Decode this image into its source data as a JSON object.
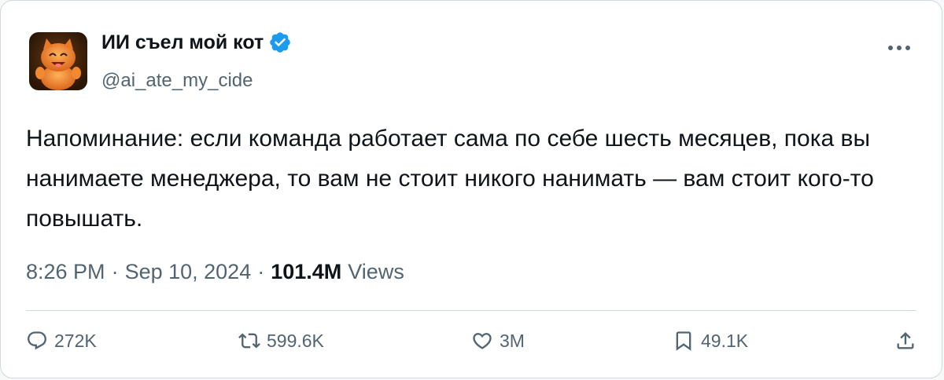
{
  "author": {
    "name": "ИИ съел мой кот",
    "handle": "@ai_ate_my_cide",
    "verified": true,
    "verified_color": "#1d9bf0"
  },
  "tweet": {
    "text": "Напоминание: если команда работает сама по себе шесть месяцев, пока вы нанимаете менеджера, то вам не стоит никого нанимать — вам стоит кого-то повышать.",
    "time": "8:26 PM",
    "date": "Sep 10, 2024",
    "views_count": "101.4M",
    "views_label": "Views",
    "separator": "·"
  },
  "actions": {
    "reply_icon": "reply-icon",
    "replies": "272K",
    "retweet_icon": "retweet-icon",
    "retweets": "599.6K",
    "like_icon": "heart-icon",
    "likes": "3M",
    "bookmark_icon": "bookmark-icon",
    "bookmarks": "49.1K",
    "share_icon": "share-icon"
  },
  "colors": {
    "text_primary": "#0f1419",
    "text_secondary": "#536471",
    "border": "#cfd9de",
    "accent": "#1d9bf0"
  }
}
